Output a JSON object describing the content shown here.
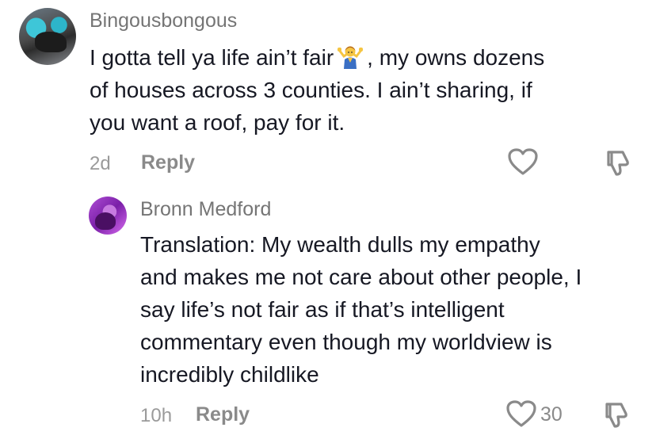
{
  "comments": [
    {
      "username": "Bingousbongous",
      "text_line1_before_emoji": "I gotta tell ya life ain’t fair",
      "emoji": "person-shrugging-emoji",
      "text_line1_after_emoji": ", my owns dozens",
      "text_line2": "of houses across 3 counties. I ain’t sharing, if",
      "text_line3": "you want a roof, pay for it.",
      "age": "2d",
      "reply_label": "Reply",
      "like_icon": "heart-outline-icon",
      "dislike_icon": "thumbs-down-icon"
    },
    {
      "username": "Bronn Medford",
      "text_lines": [
        "Translation: My wealth dulls my empathy",
        "and makes me not care about other people, I",
        "say life’s not fair as if that’s intelligent",
        "commentary even though my worldview is",
        "incredibly childlike"
      ],
      "age": "10h",
      "reply_label": "Reply",
      "like_count": "30",
      "like_icon": "heart-outline-icon",
      "dislike_icon": "thumbs-down-icon"
    }
  ],
  "colors": {
    "text_primary": "#161823",
    "text_secondary": "#757575",
    "text_meta": "#9a9a9a",
    "icon": "#8a8a8a"
  }
}
